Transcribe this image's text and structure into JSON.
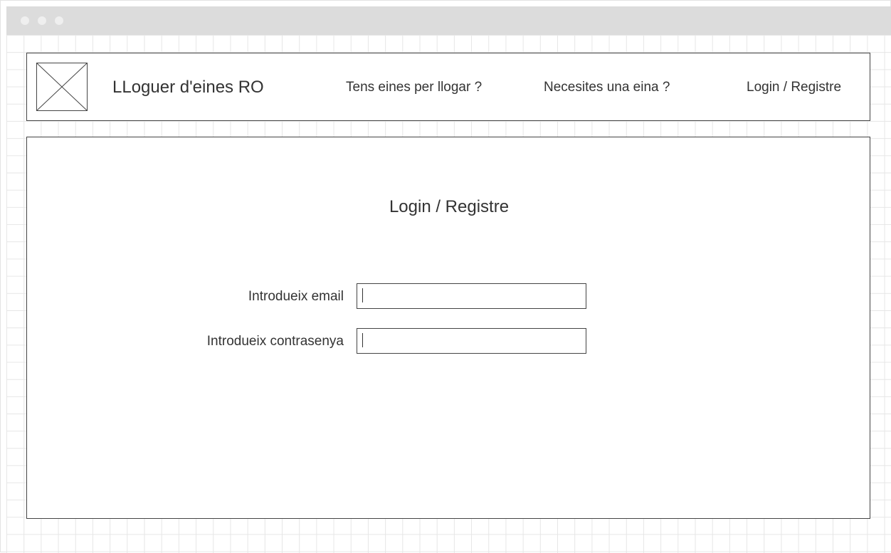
{
  "header": {
    "brand": "LLoguer d'eines RO",
    "nav": [
      {
        "label": "Tens eines per llogar ?"
      },
      {
        "label": "Necesites una eina ?"
      },
      {
        "label": "Login / Registre"
      }
    ]
  },
  "main": {
    "title": "Login / Registre",
    "email": {
      "label": "Introdueix email",
      "value": ""
    },
    "password": {
      "label": "Introdueix contrasenya",
      "value": ""
    }
  },
  "colors": {
    "border": "#444444",
    "text": "#333333",
    "titlebar": "#dcdcdc",
    "grid": "#e6e6e6"
  },
  "icons": {
    "logo": "image-placeholder-icon",
    "window_controls": [
      "window-dot-icon",
      "window-dot-icon",
      "window-dot-icon"
    ]
  }
}
